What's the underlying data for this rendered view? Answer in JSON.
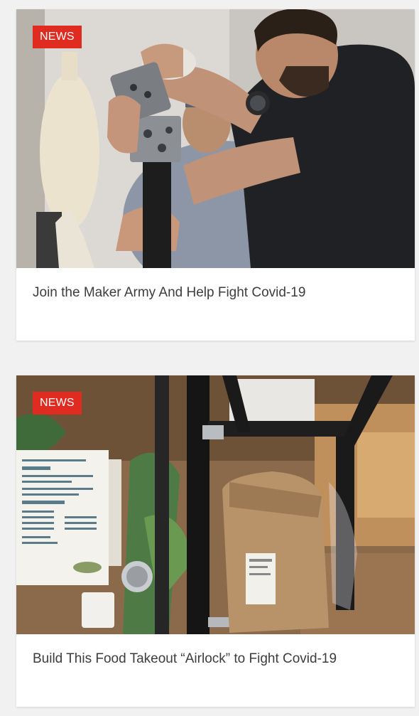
{
  "articles": [
    {
      "badge": "NEWS",
      "title": "Join the Maker Army And Help Fight Covid-19",
      "image_alt": "Maker assembling a 3D printed part on a metal rig"
    },
    {
      "badge": "NEWS",
      "title": "Build This Food Takeout “Airlock” to Fight Covid-19",
      "image_alt": "Takeout airlock cabinet with a paper bag inside"
    }
  ],
  "colors": {
    "badge_bg": "#e02b20",
    "title_text": "#3d3d3d",
    "page_bg": "#f1f1f1"
  }
}
